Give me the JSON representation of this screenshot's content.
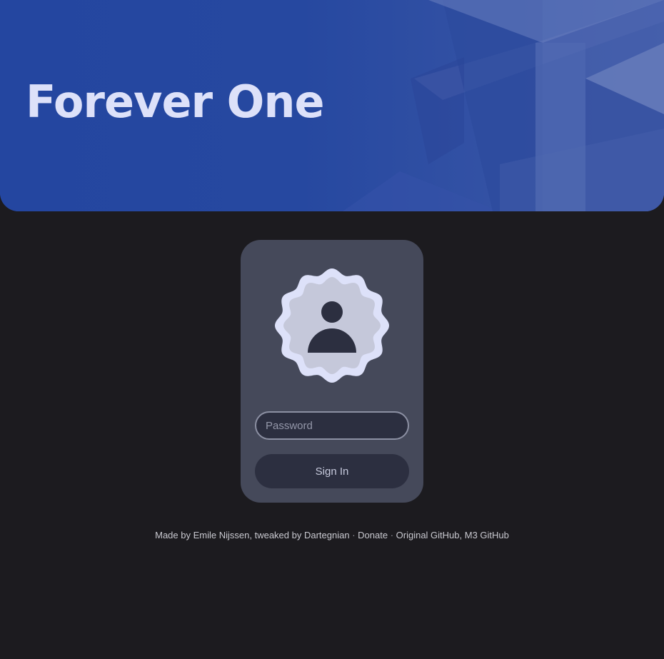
{
  "theme": {
    "page_bg": "#1c1b1f",
    "hero_bg": "#2446a0",
    "title_color": "#dde1f9",
    "card_bg": "#45495a",
    "field_bg": "#2c2f40"
  },
  "hero": {
    "title": "Forever One"
  },
  "login": {
    "avatar_icon": "user-badge-icon",
    "password_placeholder": "Password",
    "password_value": "",
    "signin_label": "Sign In"
  },
  "footer": {
    "made_by": "Made by",
    "author": "Emile Nijssen",
    "tweaked_by": ", tweaked by",
    "tweaker": "Dartegnian",
    "sep1": " · ",
    "donate": "Donate",
    "sep2": " · ",
    "original_github": "Original GitHub",
    "comma": ", ",
    "m3_github": "M3 GitHub"
  }
}
